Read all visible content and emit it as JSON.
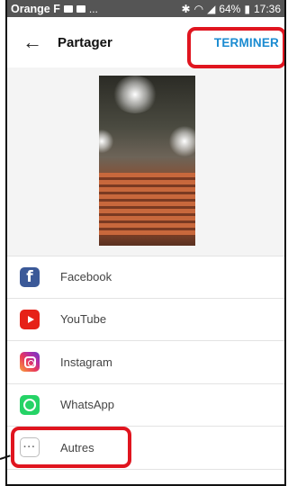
{
  "status_bar": {
    "carrier": "Orange F",
    "notifications": "...",
    "battery": "64%",
    "time": "17:36"
  },
  "app_bar": {
    "back_icon": "arrow-left-icon",
    "title": "Partager",
    "done_label": "TERMINER"
  },
  "share_targets": [
    {
      "label": "Facebook",
      "icon": "facebook-icon"
    },
    {
      "label": "YouTube",
      "icon": "youtube-icon"
    },
    {
      "label": "Instagram",
      "icon": "instagram-icon"
    },
    {
      "label": "WhatsApp",
      "icon": "whatsapp-icon"
    },
    {
      "label": "Autres",
      "icon": "more-icon",
      "icon_glyph": "···"
    }
  ],
  "colors": {
    "accent": "#1a8bd1",
    "highlight": "#e0151f",
    "status_bar": "#555555"
  }
}
